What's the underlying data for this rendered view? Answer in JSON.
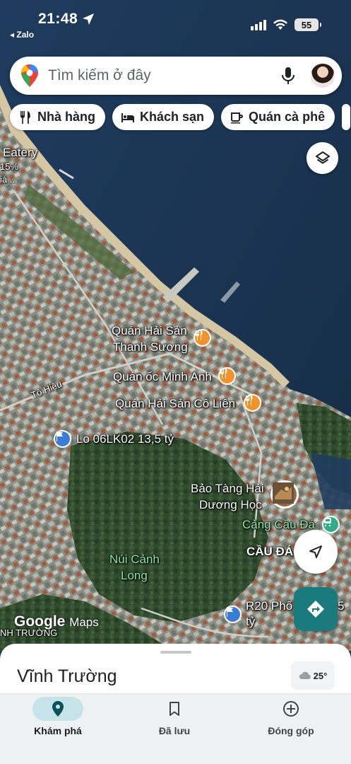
{
  "status_bar": {
    "time": "21:48",
    "back_app": "◂ Zalo",
    "battery": "55"
  },
  "search": {
    "placeholder": "Tìm kiếm ở đây"
  },
  "chips": [
    {
      "label": "Nhà hàng",
      "icon": "restaurant-icon"
    },
    {
      "label": "Khách sạn",
      "icon": "hotel-icon"
    },
    {
      "label": "Quán cà phê",
      "icon": "coffee-icon"
    }
  ],
  "map_labels": {
    "eatery": "Eatery",
    "eatery_pct": "15%",
    "eatery_sub": "iá ...",
    "street": "Tô Hiệu",
    "poi_1_line1": "Quán Hải Sản",
    "poi_1_line2": "Thanh Sương",
    "poi_2": "Quán ốc Minh Anh",
    "poi_3": "Quán Hải Sản Cô Liên",
    "lot": "Lo 06LK02 13,5 tỷ",
    "museum_line1": "Bảo Tàng Hải",
    "museum_line2": "Dương Học",
    "port": "Cảng Cầu Đá",
    "area": "CẦU ĐÁ",
    "mountain_line1": "Núi Cảnh",
    "mountain_line2": "Long",
    "r20_line1": "R20 Phố",
    "r20_5": "5",
    "r20_line2": "tỷ",
    "bottom_left": "NH TRƯỜNG",
    "google": "Google",
    "maps": "Maps"
  },
  "sheet": {
    "title": "Vĩnh Trường",
    "temperature": "25°"
  },
  "bottom_nav": [
    {
      "label": "Khám phá",
      "icon": "explore-pin-icon",
      "active": true
    },
    {
      "label": "Đã lưu",
      "icon": "bookmark-icon",
      "active": false
    },
    {
      "label": "Đóng góp",
      "icon": "add-circle-icon",
      "active": false
    }
  ],
  "colors": {
    "sea": "#1d3a55",
    "accent_teal": "#1a7a7e",
    "poi_food": "#f3922a",
    "poi_blue": "#3a7bd5",
    "poi_port": "#2fae88",
    "label_green": "#8fe4a8",
    "nav_active_pill": "#c7e3ea"
  }
}
